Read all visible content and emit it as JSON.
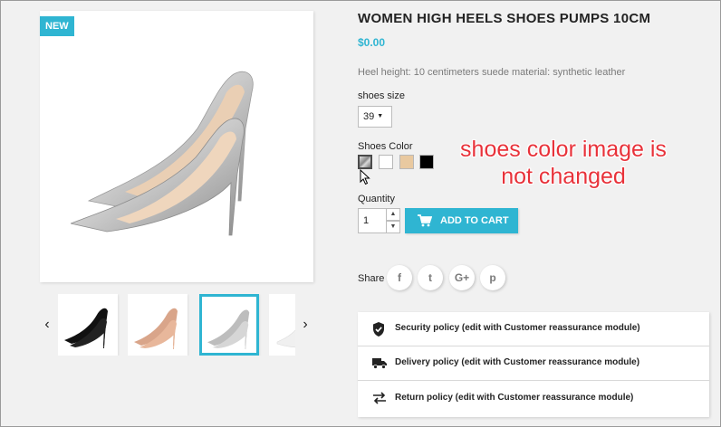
{
  "product": {
    "badge": "New",
    "title": "Women High Heels Shoes Pumps 10cm",
    "price": "$0.00",
    "description": "Heel height: 10 centimeters suede material: synthetic leather",
    "size_label": "shoes size",
    "size_value": "39",
    "color_label": "Shoes Color",
    "colors": [
      {
        "name": "silver",
        "hex": "#a9a9a9",
        "selected": true
      },
      {
        "name": "white",
        "hex": "#ffffff",
        "selected": false
      },
      {
        "name": "nude",
        "hex": "#e9c9a0",
        "selected": false
      },
      {
        "name": "black",
        "hex": "#000000",
        "selected": false
      }
    ],
    "quantity_label": "Quantity",
    "quantity_value": "1",
    "add_to_cart_label": "Add to cart",
    "share_label": "Share",
    "social": [
      "f",
      "t",
      "G+",
      "p"
    ]
  },
  "gallery": {
    "thumbnails": [
      "black-pump",
      "nude-pump",
      "silver-pump",
      "white-pump"
    ],
    "selected_index": 2
  },
  "reassurance": [
    {
      "icon": "shield-icon",
      "label": "Security policy (edit with Customer reassurance module)"
    },
    {
      "icon": "truck-icon",
      "label": "Delivery policy (edit with Customer reassurance module)"
    },
    {
      "icon": "swap-arrows-icon",
      "label": "Return policy (edit with Customer reassurance module)"
    }
  ],
  "annotation": {
    "line1": "shoes color image is",
    "line2": "not changed"
  },
  "theme": {
    "accent": "#2fb5d2",
    "annotation_color": "#e8323a"
  }
}
